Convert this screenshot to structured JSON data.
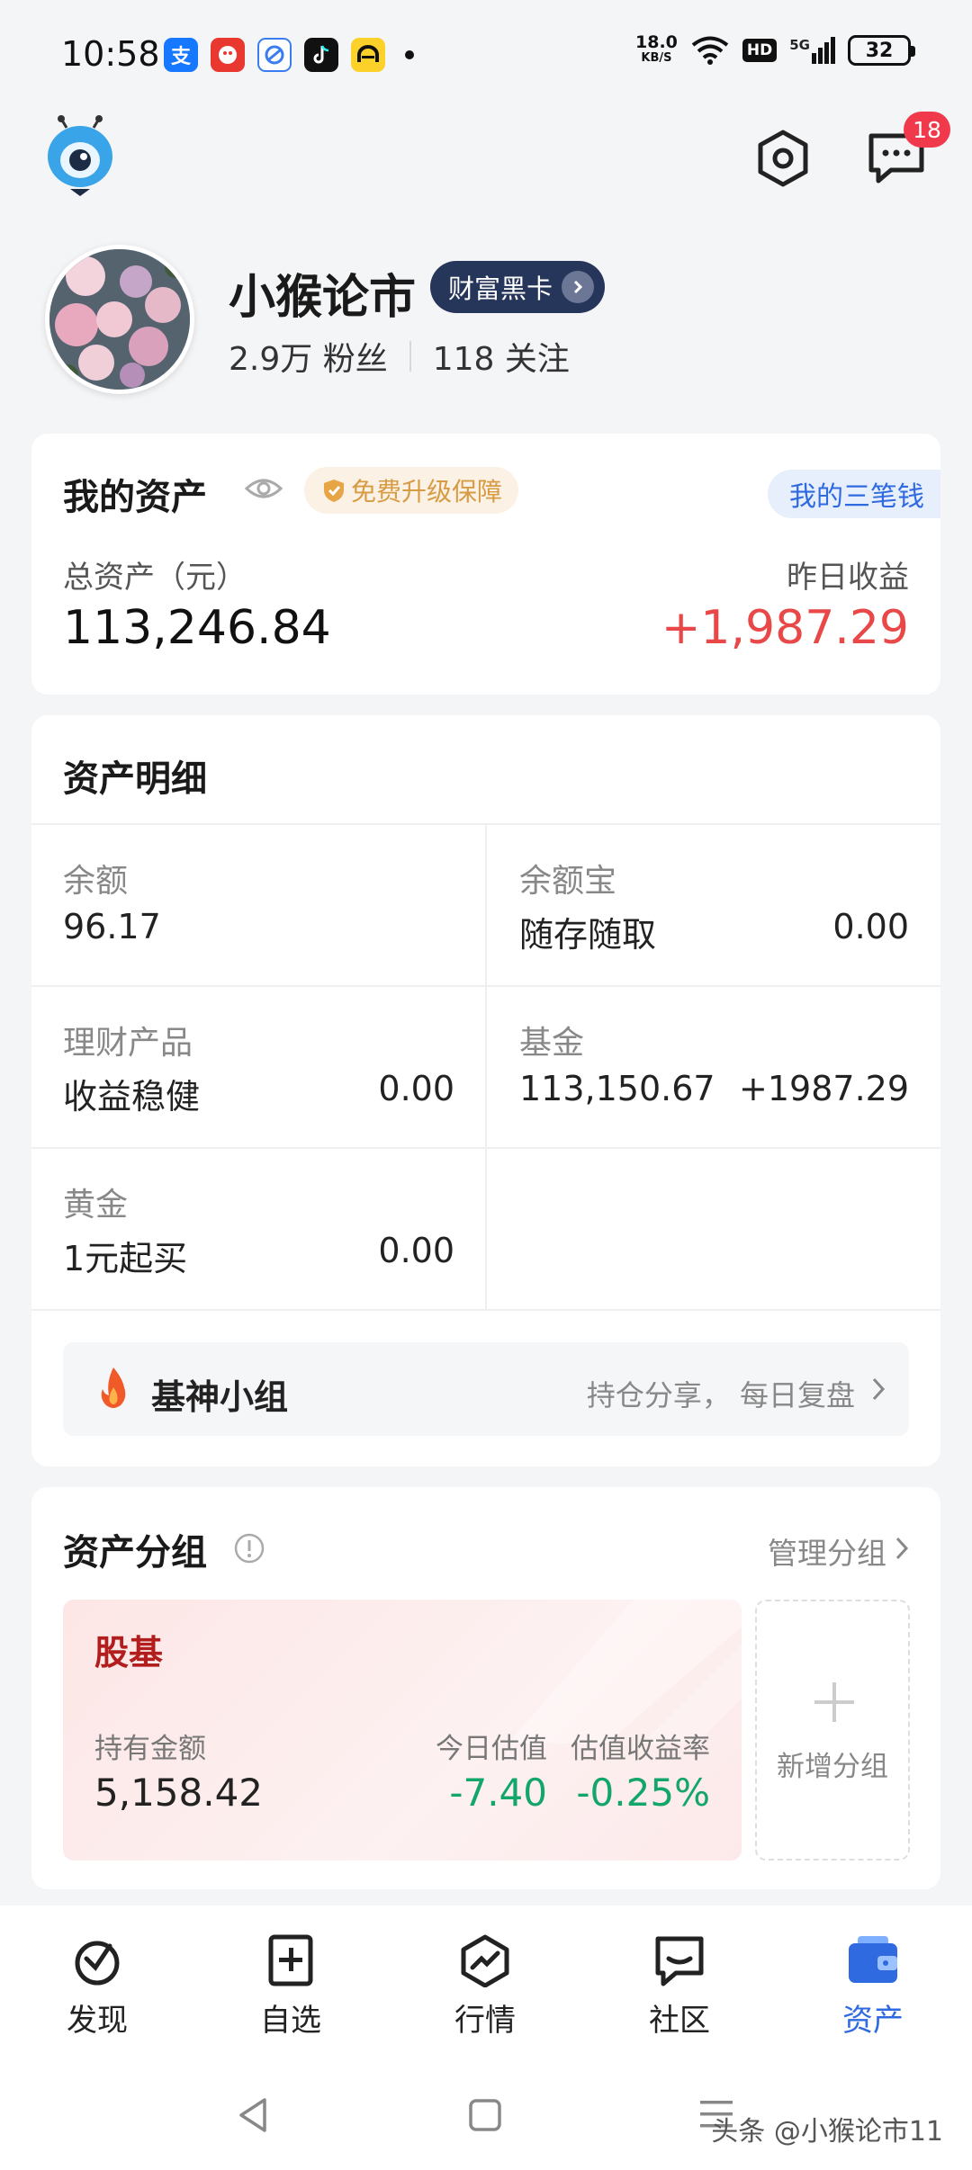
{
  "status_bar": {
    "time": "10:58",
    "net_speed_value": "18.0",
    "net_speed_unit": "KB/S",
    "hd_label": "HD",
    "network_label": "5G",
    "battery": "32"
  },
  "header": {
    "message_badge": "18"
  },
  "profile": {
    "name": "小猴论市",
    "vip_label": "财富黑卡",
    "followers": "2.9万 粉丝",
    "following": "118 关注"
  },
  "assets": {
    "title": "我的资产",
    "upgrade_label": "免费升级保障",
    "three_money_label": "我的三笔钱",
    "total_label": "总资产（元）",
    "total_value": "113,246.84",
    "yesterday_label": "昨日收益",
    "yesterday_value": "+1,987.29"
  },
  "detail": {
    "title": "资产明细",
    "cells": [
      {
        "title": "余额",
        "subtitle": "96.17",
        "value": "",
        "change": ""
      },
      {
        "title": "余额宝",
        "subtitle": "随存随取",
        "value": "0.00",
        "change": ""
      },
      {
        "title": "理财产品",
        "subtitle": "收益稳健",
        "value": "0.00",
        "change": ""
      },
      {
        "title": "基金",
        "subtitle": "113,150.67",
        "value": "",
        "change": "+1987.29"
      },
      {
        "title": "黄金",
        "subtitle": "1元起买",
        "value": "0.00",
        "change": ""
      }
    ],
    "group_banner": {
      "name": "基神小组",
      "subtitle": "持仓分享，  每日复盘"
    }
  },
  "groups": {
    "title": "资产分组",
    "manage_label": "管理分组",
    "card": {
      "name": "股基",
      "holding_label": "持有金额",
      "holding_value": "5,158.42",
      "estimate_label": "今日估值",
      "estimate_value": "-7.40",
      "rate_label": "估值收益率",
      "rate_value": "-0.25%"
    },
    "add_label": "新增分组"
  },
  "bottom_nav": {
    "items": [
      {
        "label": "发现",
        "icon": "discover-icon"
      },
      {
        "label": "自选",
        "icon": "watchlist-icon"
      },
      {
        "label": "行情",
        "icon": "market-icon"
      },
      {
        "label": "社区",
        "icon": "community-icon"
      },
      {
        "label": "资产",
        "icon": "assets-wallet-icon"
      }
    ],
    "active_index": 4
  },
  "watermark": "头条 @小猴论市11",
  "colors": {
    "accent_blue": "#2f6ae0",
    "gain_red": "#e84848",
    "loss_green": "#13a66a",
    "vip_navy": "#26355a",
    "badge_red": "#f0394b"
  }
}
